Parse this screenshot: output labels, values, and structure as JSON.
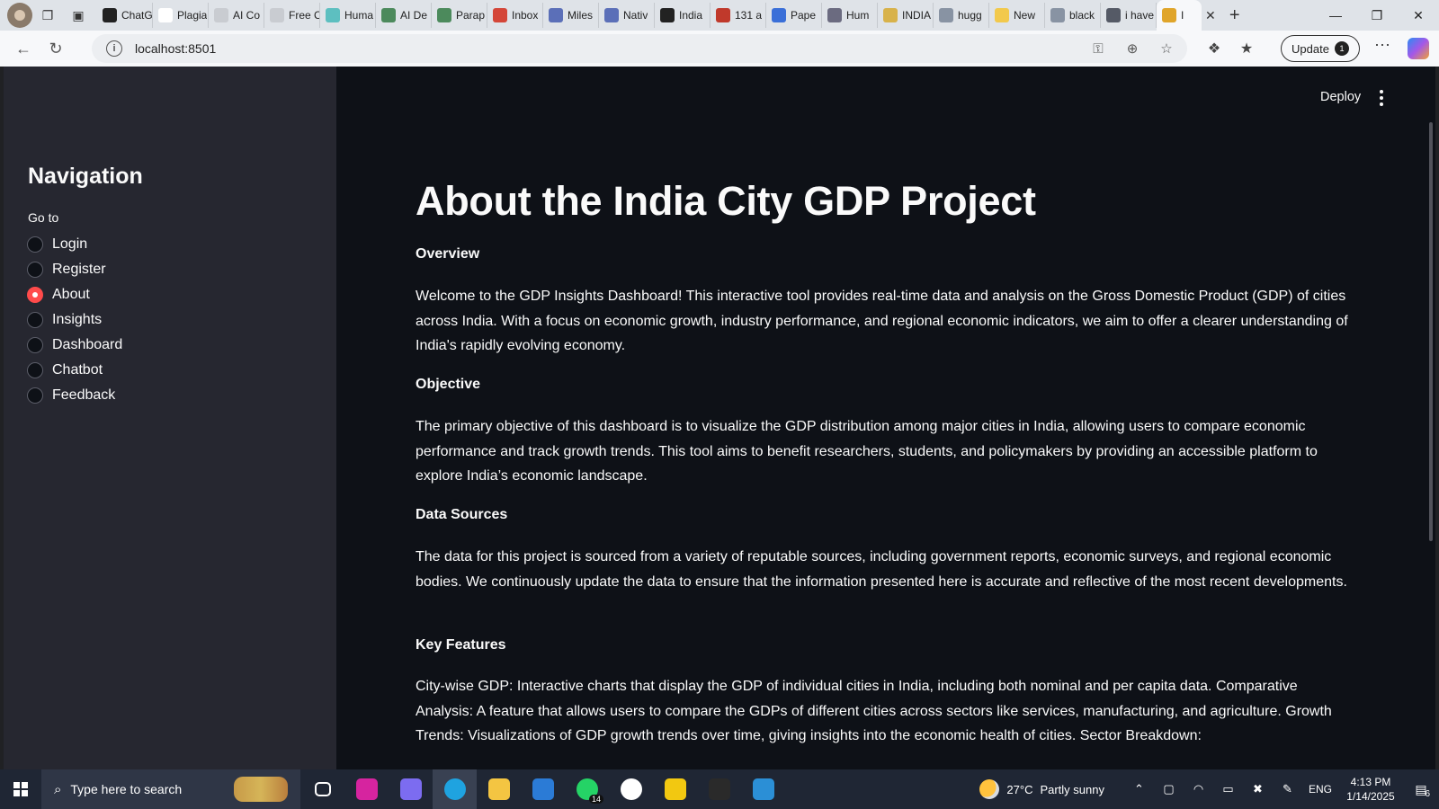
{
  "browser": {
    "tabs": [
      {
        "title": "ChatG",
        "color": "#222222"
      },
      {
        "title": "Plagia",
        "color": "#ffffff"
      },
      {
        "title": "AI Co",
        "color": "#c9ccd1"
      },
      {
        "title": "Free C",
        "color": "#c9ccd1"
      },
      {
        "title": "Huma",
        "color": "#5dbfc0"
      },
      {
        "title": "AI De",
        "color": "#4c8a5c"
      },
      {
        "title": "Parap",
        "color": "#4c8a5c"
      },
      {
        "title": "Inbox",
        "color": "#d44638"
      },
      {
        "title": "Miles",
        "color": "#5b6fb8"
      },
      {
        "title": "Nativ",
        "color": "#5b6fb8"
      },
      {
        "title": "India",
        "color": "#222222"
      },
      {
        "title": "131 a",
        "color": "#c0392b"
      },
      {
        "title": "Pape",
        "color": "#3a6fd8"
      },
      {
        "title": "Hum",
        "color": "#6b6b80"
      },
      {
        "title": "INDIA",
        "color": "#d8b24a"
      },
      {
        "title": "hugg",
        "color": "#8893a3"
      },
      {
        "title": "New",
        "color": "#f2c94c"
      },
      {
        "title": "black",
        "color": "#8893a3"
      },
      {
        "title": "i have",
        "color": "#555a66"
      }
    ],
    "active_tab": {
      "title": "I",
      "color": "#e0a52a"
    },
    "url": "localhost:8501",
    "update_label": "Update",
    "update_badge": "1"
  },
  "header": {
    "deploy_label": "Deploy"
  },
  "sidebar": {
    "title": "Navigation",
    "goto_label": "Go to",
    "items": [
      {
        "label": "Login",
        "selected": false
      },
      {
        "label": "Register",
        "selected": false
      },
      {
        "label": "About",
        "selected": true
      },
      {
        "label": "Insights",
        "selected": false
      },
      {
        "label": "Dashboard",
        "selected": false
      },
      {
        "label": "Chatbot",
        "selected": false
      },
      {
        "label": "Feedback",
        "selected": false
      }
    ]
  },
  "main": {
    "title": "About the India City GDP Project",
    "sections": [
      {
        "heading": "Overview",
        "text": "Welcome to the GDP Insights Dashboard! This interactive tool provides real-time data and analysis on the Gross Domestic Product (GDP) of cities across India. With a focus on economic growth, industry performance, and regional economic indicators, we aim to offer a clearer understanding of India's rapidly evolving economy."
      },
      {
        "heading": "Objective",
        "text": "The primary objective of this dashboard is to visualize the GDP distribution among major cities in India, allowing users to compare economic performance and track growth trends. This tool aims to benefit researchers, students, and policymakers by providing an accessible platform to explore India’s economic landscape."
      },
      {
        "heading": "Data Sources",
        "text": "The data for this project is sourced from a variety of reputable sources, including government reports, economic surveys, and regional economic bodies. We continuously update the data to ensure that the information presented here is accurate and reflective of the most recent developments."
      },
      {
        "heading": "Key Features",
        "text": "City-wise GDP: Interactive charts that display the GDP of individual cities in India, including both nominal and per capita data. Comparative Analysis: A feature that allows users to compare the GDPs of different cities across sectors like services, manufacturing, and agriculture. Growth Trends: Visualizations of GDP growth trends over time, giving insights into the economic health of cities. Sector Breakdown:"
      }
    ]
  },
  "taskbar": {
    "search_placeholder": "Type here to search",
    "apps": [
      {
        "name": "task-view",
        "color": "#ffffff"
      },
      {
        "name": "instagram",
        "color": "#d6249f"
      },
      {
        "name": "copilot",
        "color": "#7c6cf0"
      },
      {
        "name": "edge",
        "color": "#1fa3e0"
      },
      {
        "name": "file-explorer",
        "color": "#f4c542"
      },
      {
        "name": "microsoft-store",
        "color": "#2b7bd6"
      },
      {
        "name": "whatsapp",
        "color": "#25d366",
        "count": "14"
      },
      {
        "name": "settings",
        "color": "#ffffff"
      },
      {
        "name": "power-bi",
        "color": "#f2c811"
      },
      {
        "name": "terminal",
        "color": "#2a2a2a"
      },
      {
        "name": "vscode",
        "color": "#2b8fd6"
      }
    ],
    "weather_temp": "27°C",
    "weather_desc": "Partly sunny",
    "lang": "ENG",
    "time": "4:13 PM",
    "date": "1/14/2025",
    "notif_count": "6"
  }
}
